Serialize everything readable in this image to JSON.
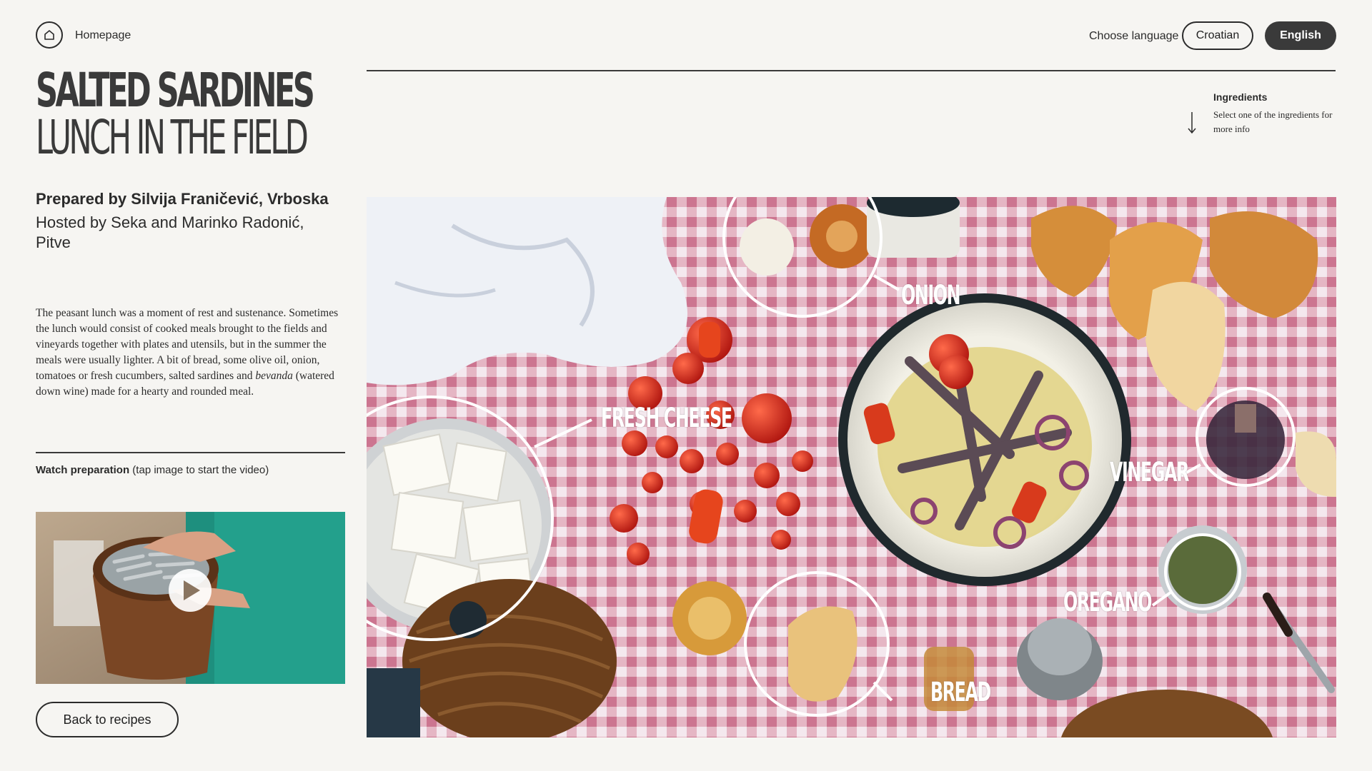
{
  "header": {
    "home_label": "Homepage",
    "choose_language": "Choose language",
    "lang_croatian": "Croatian",
    "lang_english": "English"
  },
  "recipe": {
    "title_line1": "SALTED SARDINES",
    "title_line2": "LUNCH IN THE FIELD",
    "prepared_by": "Prepared by Silvija Franičević, Vrboska",
    "hosted_by": "Hosted by Seka and Marinko Radonić, Pitve",
    "description_part1": "The peasant lunch was a moment of rest and sustenance. Sometimes the lunch would consist of cooked meals brought to the fields and vineyards together with plates and utensils, but in the summer the meals were usually lighter. A bit of bread, some olive oil, onion, tomatoes or fresh cucumbers, salted sardines and ",
    "description_italic": "bevanda",
    "description_part2": " (watered down wine) made for a hearty and rounded meal."
  },
  "ingredients_hint": {
    "title": "Ingredients",
    "subtitle": "Select one of the ingredients for more info"
  },
  "video": {
    "watch_bold": "Watch preparation",
    "watch_rest": " (tap image to start the video)"
  },
  "back_button": "Back to recipes",
  "ingredients": {
    "onion": "ONION",
    "fresh_cheese": "FRESH CHEESE",
    "vinegar": "VINEGAR",
    "oregano": "OREGANO",
    "bread": "BREAD"
  },
  "colors": {
    "background": "#f6f5f2",
    "text": "#262626",
    "button_dark": "#3a3a3a",
    "tablecloth_check": "#c9667f"
  },
  "icons": [
    "home-icon",
    "arrow-down-icon",
    "play-icon"
  ]
}
